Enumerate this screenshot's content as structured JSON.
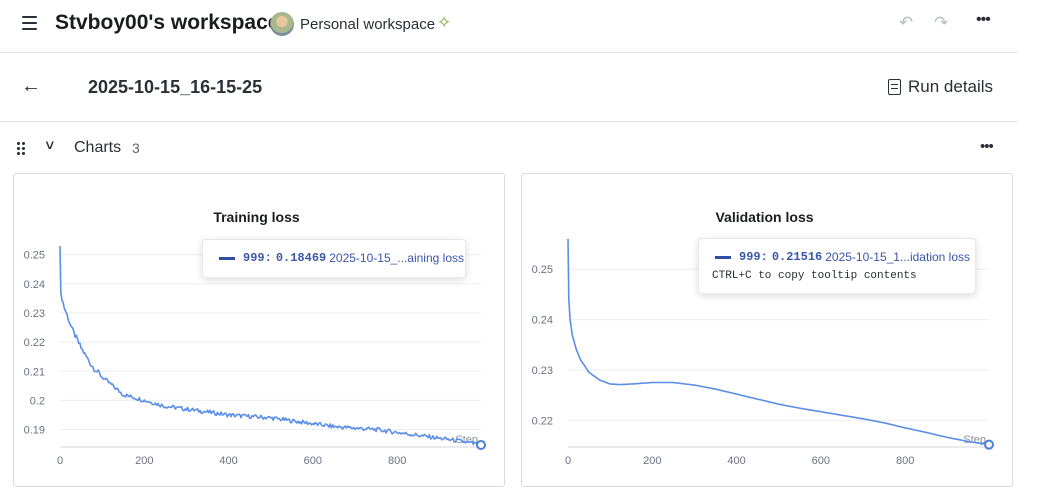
{
  "header": {
    "workspace_title": "Stvboy00's workspace",
    "workspace_subtitle": "Personal workspace",
    "icons": [
      "menu-icon",
      "avatar",
      "sparkle-icon",
      "undo-icon",
      "redo-icon",
      "more-icon"
    ]
  },
  "run": {
    "name": "2025-10-15_16-15-25",
    "details_label": "Run details"
  },
  "section": {
    "label": "Charts",
    "count": "3"
  },
  "colors": {
    "series": "#5b8ee6",
    "tooltip_text": "#3a56a8",
    "accent": "#7aa33a"
  },
  "charts": [
    {
      "title": "Training loss",
      "tooltip": {
        "step": "999",
        "value": "0.18469",
        "name": "2025-10-15_...aining loss"
      },
      "step_label": "Step"
    },
    {
      "title": "Validation loss",
      "tooltip": {
        "step": "999",
        "value": "0.21516",
        "name": "2025-10-15_1...idation loss",
        "hint": "CTRL+C to copy tooltip contents"
      },
      "step_label": "Step"
    }
  ],
  "chart_data": [
    {
      "type": "line",
      "title": "Training loss",
      "xlabel": "Step",
      "ylabel": "",
      "x_ticks": [
        0,
        200,
        400,
        600,
        800
      ],
      "y_ticks": [
        0.19,
        0.2,
        0.21,
        0.22,
        0.23,
        0.24,
        0.25
      ],
      "xlim": [
        0,
        999
      ],
      "ylim": [
        0.184,
        0.253
      ],
      "grid": true,
      "series": [
        {
          "x": [
            0,
            2,
            5,
            10,
            20,
            30,
            50,
            75,
            100,
            125,
            150,
            200,
            250,
            300,
            350,
            400,
            450,
            500,
            550,
            600,
            650,
            700,
            750,
            800,
            850,
            900,
            950,
            999
          ],
          "y": [
            0.253,
            0.237,
            0.235,
            0.232,
            0.228,
            0.224,
            0.218,
            0.212,
            0.208,
            0.205,
            0.202,
            0.2,
            0.198,
            0.197,
            0.196,
            0.195,
            0.1945,
            0.194,
            0.193,
            0.192,
            0.191,
            0.1905,
            0.19,
            0.189,
            0.188,
            0.187,
            0.186,
            0.18469
          ]
        }
      ]
    },
    {
      "type": "line",
      "title": "Validation loss",
      "xlabel": "Step",
      "ylabel": "",
      "x_ticks": [
        0,
        200,
        400,
        600,
        800
      ],
      "y_ticks": [
        0.22,
        0.23,
        0.24,
        0.25
      ],
      "xlim": [
        0,
        999
      ],
      "ylim": [
        0.2147,
        0.2562
      ],
      "grid": true,
      "series": [
        {
          "x": [
            0,
            2,
            5,
            10,
            20,
            30,
            50,
            75,
            100,
            125,
            150,
            200,
            250,
            300,
            350,
            400,
            450,
            500,
            550,
            600,
            650,
            700,
            750,
            800,
            850,
            900,
            950,
            999
          ],
          "y": [
            0.256,
            0.244,
            0.24,
            0.237,
            0.234,
            0.232,
            0.2295,
            0.228,
            0.2272,
            0.2271,
            0.2272,
            0.2275,
            0.2275,
            0.227,
            0.2262,
            0.2252,
            0.2242,
            0.2232,
            0.2224,
            0.2217,
            0.221,
            0.2203,
            0.2195,
            0.2185,
            0.2176,
            0.2166,
            0.2158,
            0.21516
          ]
        }
      ]
    }
  ]
}
